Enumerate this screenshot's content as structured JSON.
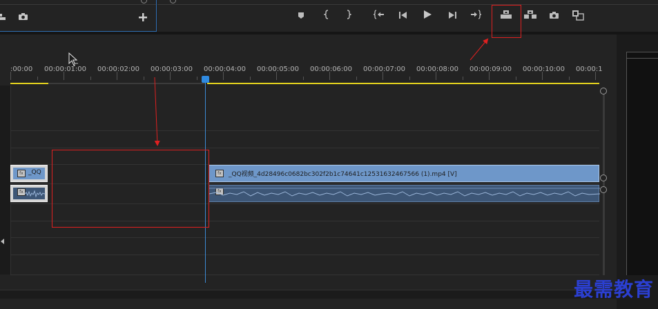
{
  "top_left_panel": {
    "icons": [
      "export-frame-icon",
      "camera-icon",
      "plus-icon"
    ]
  },
  "transport": {
    "buttons": [
      {
        "name": "add-marker-button",
        "glyph": "⬟"
      },
      {
        "name": "mark-in-button",
        "glyph": "{"
      },
      {
        "name": "mark-out-button",
        "glyph": "}"
      },
      {
        "name": "go-to-in-button",
        "glyph": "{←"
      },
      {
        "name": "step-back-button",
        "glyph": "◀|"
      },
      {
        "name": "play-button",
        "glyph": "▶"
      },
      {
        "name": "step-forward-button",
        "glyph": "|▶"
      },
      {
        "name": "go-to-out-button",
        "glyph": "→}"
      },
      {
        "name": "lift-button",
        "glyph": "⏏"
      },
      {
        "name": "extract-button",
        "glyph": "⎙"
      },
      {
        "name": "export-frame-button",
        "glyph": "📷"
      },
      {
        "name": "comparison-view-button",
        "glyph": "▣"
      }
    ]
  },
  "ruler": {
    "timecodes": [
      ":00:00",
      "00:00:01:00",
      "00:00:02:00",
      "00:00:03:00",
      "00:00:04:00",
      "00:00:05:00",
      "00:00:06:00",
      "00:00:07:00",
      "00:00:08:00",
      "00:00:09:00",
      "00:00:10:00",
      "00:00:1"
    ]
  },
  "clips": {
    "video_small_label": "_QQ",
    "video_main_label": "_QQ视频_4d28496c0682bc302f2b1c74641c12531632467566 (1).mp4 [V]",
    "fx_label": "fx"
  },
  "watermark": {
    "text": "最需教育"
  },
  "colors": {
    "accent_blue": "#2f8ae0",
    "video_clip": "#6e97c9",
    "audio_clip": "#3d5676",
    "annotation_red": "#e02020",
    "work_area_yellow": "#e4d21e",
    "watermark_blue": "#2b3fd1"
  }
}
